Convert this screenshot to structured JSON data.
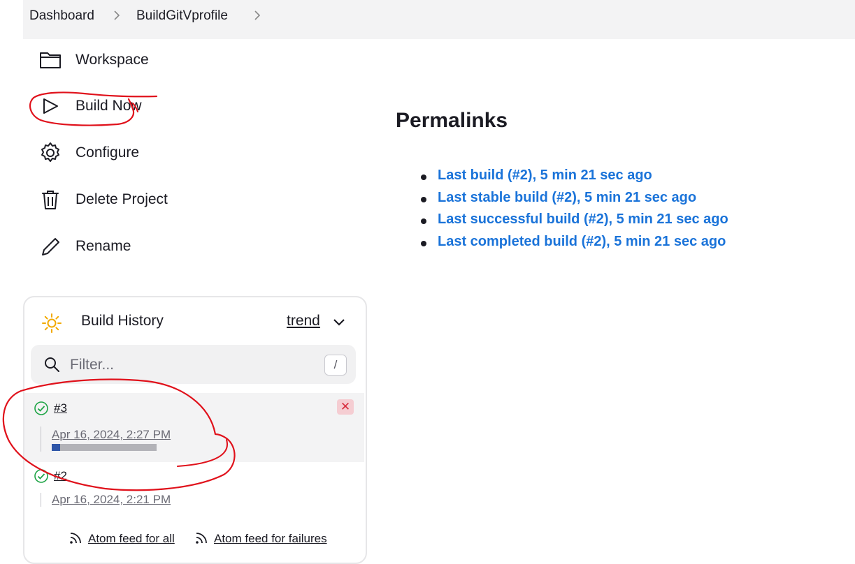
{
  "breadcrumb": {
    "items": [
      "Dashboard",
      "BuildGitVprofile"
    ]
  },
  "sidebar": {
    "items": [
      {
        "label": "Workspace",
        "icon": "folder-icon"
      },
      {
        "label": "Build Now",
        "icon": "play-icon"
      },
      {
        "label": "Configure",
        "icon": "gear-icon"
      },
      {
        "label": "Delete Project",
        "icon": "trash-icon"
      },
      {
        "label": "Rename",
        "icon": "pencil-icon"
      }
    ]
  },
  "permalinks": {
    "title": "Permalinks",
    "links": [
      "Last build (#2), 5 min 21 sec ago",
      "Last stable build (#2), 5 min 21 sec ago",
      "Last successful build (#2), 5 min 21 sec ago",
      "Last completed build (#2), 5 min 21 sec ago"
    ]
  },
  "build_history": {
    "title": "Build History",
    "trend_label": "trend",
    "filter_placeholder": "Filter...",
    "filter_shortcut": "/",
    "builds": [
      {
        "number": "#3",
        "date": "Apr 16, 2024, 2:27 PM",
        "status": "success",
        "in_progress": true,
        "progress_fraction": 0.08,
        "cancel_label": "✕"
      },
      {
        "number": "#2",
        "date": "Apr 16, 2024, 2:21 PM",
        "status": "success",
        "in_progress": false
      }
    ],
    "feeds": {
      "all": "Atom feed for all",
      "failures": "Atom feed for failures"
    }
  },
  "colors": {
    "link": "#1a73d9",
    "success": "#1ea446",
    "annotation": "#e0111b",
    "progress": "#2f56a8"
  }
}
